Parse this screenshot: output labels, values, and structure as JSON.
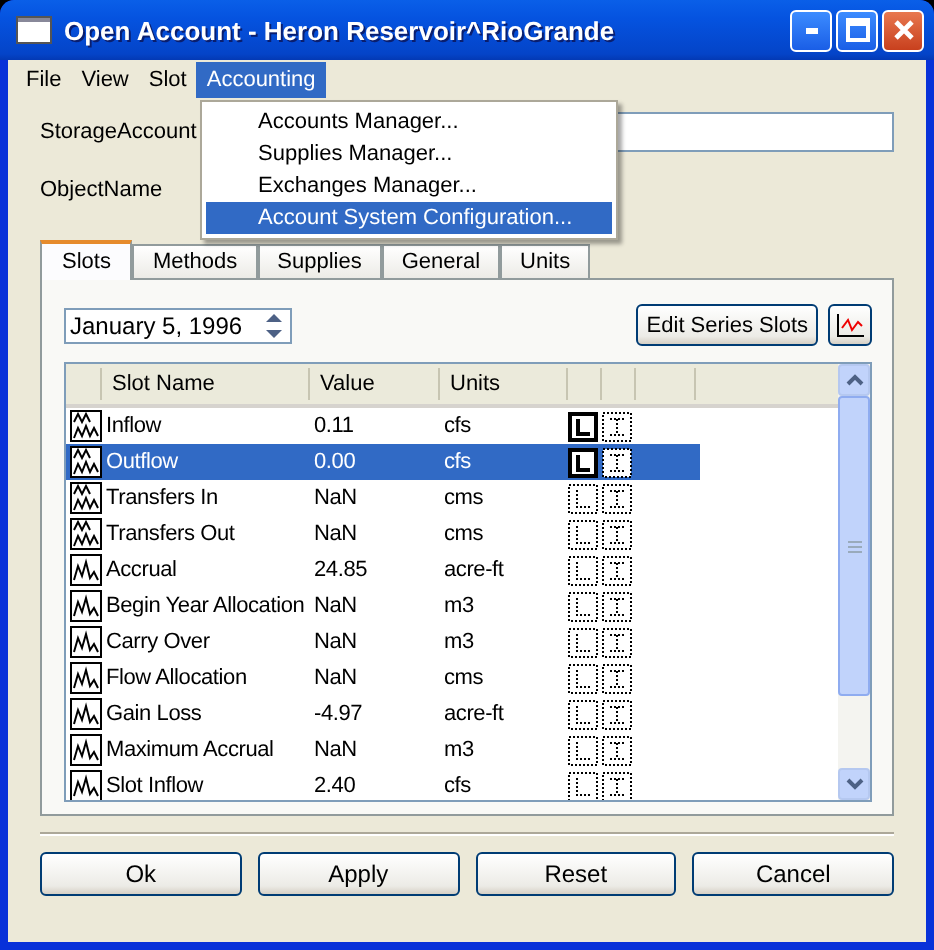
{
  "window": {
    "title": "Open Account - Heron Reservoir^RioGrande"
  },
  "menu_bar": [
    {
      "label": "File",
      "selected": false
    },
    {
      "label": "View",
      "selected": false
    },
    {
      "label": "Slot",
      "selected": false
    },
    {
      "label": "Accounting",
      "selected": true
    }
  ],
  "accounting_menu": [
    {
      "label": "Accounts Manager...",
      "selected": false
    },
    {
      "label": "Supplies Manager...",
      "selected": false
    },
    {
      "label": "Exchanges Manager...",
      "selected": false
    },
    {
      "label": "Account System Configuration...",
      "selected": true
    }
  ],
  "fields": [
    {
      "label": "StorageAccount"
    },
    {
      "label": "ObjectName"
    }
  ],
  "tabs": [
    {
      "label": "Slots",
      "selected": true
    },
    {
      "label": "Methods",
      "selected": false
    },
    {
      "label": "Supplies",
      "selected": false
    },
    {
      "label": "General",
      "selected": false
    },
    {
      "label": "Units",
      "selected": false
    }
  ],
  "date": {
    "value": "January 5, 1996"
  },
  "edit_series_button": "Edit Series Slots",
  "table": {
    "columns": [
      "Slot Name",
      "Value",
      "Units"
    ],
    "rows": [
      {
        "kind": "series-marked",
        "name": "Inflow",
        "value": "0.11",
        "units": "cfs",
        "l_flag": true,
        "selected": false
      },
      {
        "kind": "series-marked",
        "name": "Outflow",
        "value": "0.00",
        "units": "cfs",
        "l_flag": true,
        "selected": true
      },
      {
        "kind": "series-marked",
        "name": "Transfers In",
        "value": "NaN",
        "units": "cms",
        "l_flag": false,
        "selected": false
      },
      {
        "kind": "series-marked",
        "name": "Transfers Out",
        "value": "NaN",
        "units": "cms",
        "l_flag": false,
        "selected": false
      },
      {
        "kind": "series",
        "name": "Accrual",
        "value": "24.85",
        "units": "acre-ft",
        "l_flag": false,
        "selected": false
      },
      {
        "kind": "series",
        "name": "Begin Year Allocation",
        "value": "NaN",
        "units": "m3",
        "l_flag": false,
        "selected": false
      },
      {
        "kind": "series",
        "name": "Carry Over",
        "value": "NaN",
        "units": "m3",
        "l_flag": false,
        "selected": false
      },
      {
        "kind": "series",
        "name": "Flow Allocation",
        "value": "NaN",
        "units": "cms",
        "l_flag": false,
        "selected": false
      },
      {
        "kind": "series",
        "name": "Gain Loss",
        "value": "-4.97",
        "units": "acre-ft",
        "l_flag": false,
        "selected": false
      },
      {
        "kind": "series",
        "name": "Maximum Accrual",
        "value": "NaN",
        "units": "m3",
        "l_flag": false,
        "selected": false
      },
      {
        "kind": "series",
        "name": "Slot Inflow",
        "value": "2.40",
        "units": "cfs",
        "l_flag": false,
        "selected": false
      }
    ]
  },
  "buttons": [
    "Ok",
    "Apply",
    "Reset",
    "Cancel"
  ]
}
